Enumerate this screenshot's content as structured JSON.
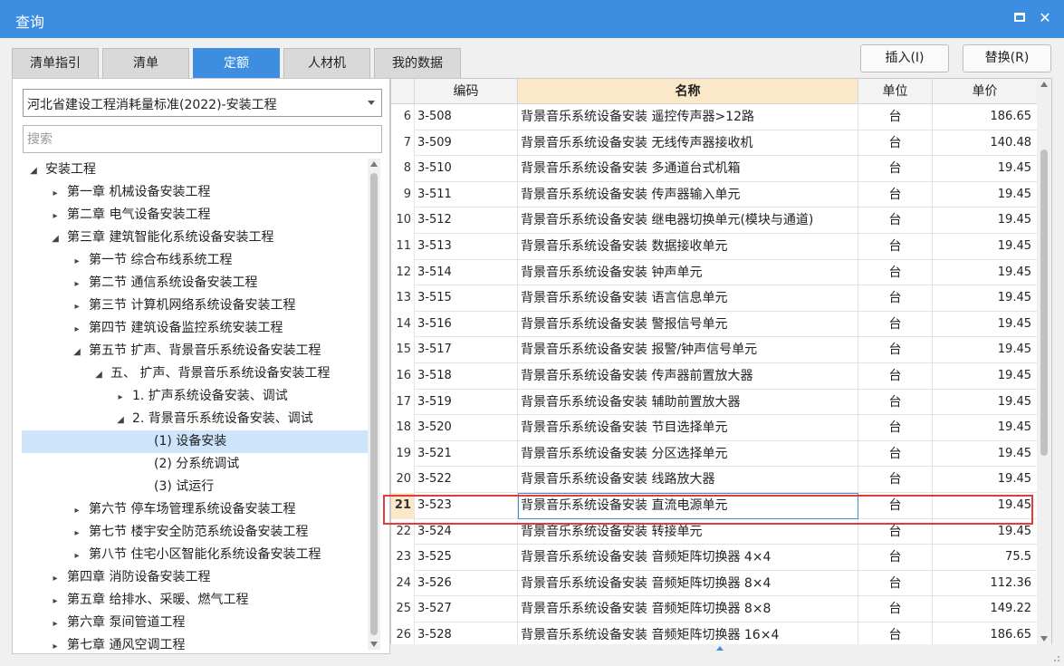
{
  "window": {
    "title": "查询"
  },
  "tabs": [
    {
      "label": "清单指引",
      "active": false
    },
    {
      "label": "清单",
      "active": false
    },
    {
      "label": "定额",
      "active": true
    },
    {
      "label": "人材机",
      "active": false
    },
    {
      "label": "我的数据",
      "active": false
    }
  ],
  "toolbar": {
    "insert_label": "插入(I)",
    "replace_label": "替换(R)"
  },
  "library": {
    "selected": "河北省建设工程消耗量标准(2022)-安装工程"
  },
  "search": {
    "placeholder": "搜索"
  },
  "tree": [
    {
      "label": "安装工程",
      "depth": 0,
      "state": "expanded"
    },
    {
      "label": "第一章 机械设备安装工程",
      "depth": 1,
      "state": "collapsed"
    },
    {
      "label": "第二章 电气设备安装工程",
      "depth": 1,
      "state": "collapsed"
    },
    {
      "label": "第三章 建筑智能化系统设备安装工程",
      "depth": 1,
      "state": "expanded"
    },
    {
      "label": "第一节 综合布线系统工程",
      "depth": 2,
      "state": "collapsed"
    },
    {
      "label": "第二节 通信系统设备安装工程",
      "depth": 2,
      "state": "collapsed"
    },
    {
      "label": "第三节 计算机网络系统设备安装工程",
      "depth": 2,
      "state": "collapsed"
    },
    {
      "label": "第四节 建筑设备监控系统安装工程",
      "depth": 2,
      "state": "collapsed"
    },
    {
      "label": "第五节 扩声、背景音乐系统设备安装工程",
      "depth": 2,
      "state": "expanded"
    },
    {
      "label": "五、 扩声、背景音乐系统设备安装工程",
      "depth": 3,
      "state": "expanded"
    },
    {
      "label": "1. 扩声系统设备安装、调试",
      "depth": 4,
      "state": "collapsed"
    },
    {
      "label": "2. 背景音乐系统设备安装、调试",
      "depth": 4,
      "state": "expanded"
    },
    {
      "label": "(1) 设备安装",
      "depth": 5,
      "state": "leaf",
      "selected": true
    },
    {
      "label": "(2) 分系统调试",
      "depth": 5,
      "state": "leaf"
    },
    {
      "label": "(3) 试运行",
      "depth": 5,
      "state": "leaf"
    },
    {
      "label": "第六节 停车场管理系统设备安装工程",
      "depth": 2,
      "state": "collapsed"
    },
    {
      "label": "第七节 楼宇安全防范系统设备安装工程",
      "depth": 2,
      "state": "collapsed"
    },
    {
      "label": "第八节 住宅小区智能化系统设备安装工程",
      "depth": 2,
      "state": "collapsed"
    },
    {
      "label": "第四章 消防设备安装工程",
      "depth": 1,
      "state": "collapsed"
    },
    {
      "label": "第五章 给排水、采暖、燃气工程",
      "depth": 1,
      "state": "collapsed"
    },
    {
      "label": "第六章 泵间管道工程",
      "depth": 1,
      "state": "collapsed"
    },
    {
      "label": "第七章 通风空调工程",
      "depth": 1,
      "state": "collapsed"
    }
  ],
  "table": {
    "columns": [
      "编码",
      "名称",
      "单位",
      "单价"
    ],
    "active_row": "21",
    "rows": [
      {
        "num": "6",
        "code": "3-508",
        "name": "背景音乐系统设备安装 遥控传声器>12路",
        "unit": "台",
        "price": "186.65"
      },
      {
        "num": "7",
        "code": "3-509",
        "name": "背景音乐系统设备安装 无线传声器接收机",
        "unit": "台",
        "price": "140.48"
      },
      {
        "num": "8",
        "code": "3-510",
        "name": "背景音乐系统设备安装 多通道台式机箱",
        "unit": "台",
        "price": "19.45"
      },
      {
        "num": "9",
        "code": "3-511",
        "name": "背景音乐系统设备安装 传声器输入单元",
        "unit": "台",
        "price": "19.45"
      },
      {
        "num": "10",
        "code": "3-512",
        "name": "背景音乐系统设备安装 继电器切换单元(模块与通道)",
        "unit": "台",
        "price": "19.45"
      },
      {
        "num": "11",
        "code": "3-513",
        "name": "背景音乐系统设备安装 数据接收单元",
        "unit": "台",
        "price": "19.45"
      },
      {
        "num": "12",
        "code": "3-514",
        "name": "背景音乐系统设备安装 钟声单元",
        "unit": "台",
        "price": "19.45"
      },
      {
        "num": "13",
        "code": "3-515",
        "name": "背景音乐系统设备安装 语言信息单元",
        "unit": "台",
        "price": "19.45"
      },
      {
        "num": "14",
        "code": "3-516",
        "name": "背景音乐系统设备安装 警报信号单元",
        "unit": "台",
        "price": "19.45"
      },
      {
        "num": "15",
        "code": "3-517",
        "name": "背景音乐系统设备安装 报警/钟声信号单元",
        "unit": "台",
        "price": "19.45"
      },
      {
        "num": "16",
        "code": "3-518",
        "name": "背景音乐系统设备安装 传声器前置放大器",
        "unit": "台",
        "price": "19.45"
      },
      {
        "num": "17",
        "code": "3-519",
        "name": "背景音乐系统设备安装 辅助前置放大器",
        "unit": "台",
        "price": "19.45"
      },
      {
        "num": "18",
        "code": "3-520",
        "name": "背景音乐系统设备安装 节目选择单元",
        "unit": "台",
        "price": "19.45"
      },
      {
        "num": "19",
        "code": "3-521",
        "name": "背景音乐系统设备安装 分区选择单元",
        "unit": "台",
        "price": "19.45"
      },
      {
        "num": "20",
        "code": "3-522",
        "name": "背景音乐系统设备安装 线路放大器",
        "unit": "台",
        "price": "19.45"
      },
      {
        "num": "21",
        "code": "3-523",
        "name": "背景音乐系统设备安装 直流电源单元",
        "unit": "台",
        "price": "19.45"
      },
      {
        "num": "22",
        "code": "3-524",
        "name": "背景音乐系统设备安装 转接单元",
        "unit": "台",
        "price": "19.45"
      },
      {
        "num": "23",
        "code": "3-525",
        "name": "背景音乐系统设备安装 音频矩阵切换器 4×4",
        "unit": "台",
        "price": "75.5"
      },
      {
        "num": "24",
        "code": "3-526",
        "name": "背景音乐系统设备安装 音频矩阵切换器 8×4",
        "unit": "台",
        "price": "112.36"
      },
      {
        "num": "25",
        "code": "3-527",
        "name": "背景音乐系统设备安装 音频矩阵切换器 8×8",
        "unit": "台",
        "price": "149.22"
      },
      {
        "num": "26",
        "code": "3-528",
        "name": "背景音乐系统设备安装 音频矩阵切换器 16×4",
        "unit": "台",
        "price": "186.65"
      }
    ]
  },
  "colors": {
    "accent": "#3d8ee0",
    "header_highlight": "#fbe8c8",
    "selection": "#cde4fb",
    "focus_outline": "#e23b3b"
  },
  "icons": {
    "maximize": "maximize-icon",
    "close": "close-icon",
    "dropdown": "chevron-down-icon"
  }
}
